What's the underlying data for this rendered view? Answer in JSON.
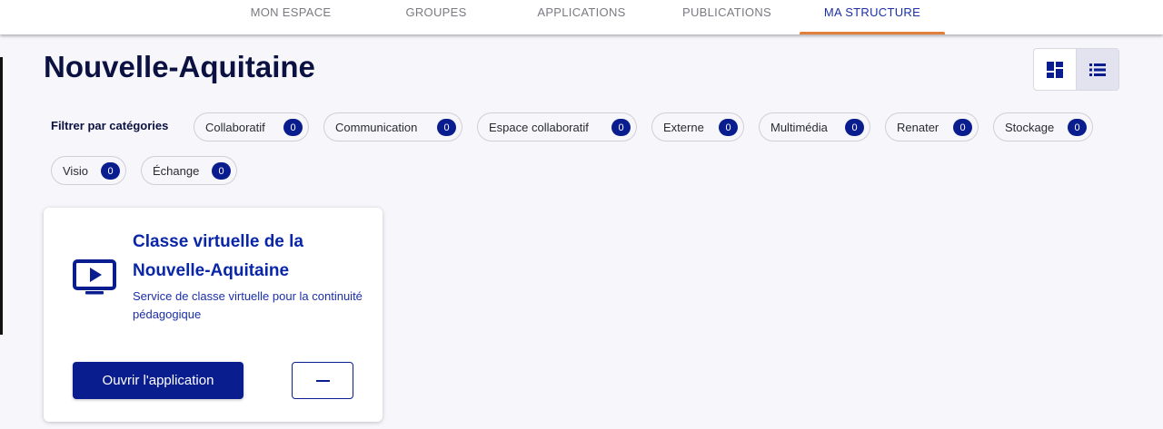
{
  "nav": {
    "tabs": [
      {
        "label": "MON ESPACE"
      },
      {
        "label": "GROUPES"
      },
      {
        "label": "APPLICATIONS"
      },
      {
        "label": "PUBLICATIONS"
      },
      {
        "label": "MA STRUCTURE",
        "active": true
      }
    ]
  },
  "page": {
    "title": "Nouvelle-Aquitaine"
  },
  "view_toggle": {
    "icons": [
      "grid-view-icon",
      "list-view-icon"
    ],
    "active": "list"
  },
  "filters": {
    "label": "Filtrer par catégories",
    "categories": [
      {
        "label": "Collaboratif",
        "count": "0"
      },
      {
        "label": "Communication",
        "count": "0"
      },
      {
        "label": "Espace collaboratif",
        "count": "0"
      },
      {
        "label": "Externe",
        "count": "0"
      },
      {
        "label": "Multimédia",
        "count": "0"
      },
      {
        "label": "Renater",
        "count": "0"
      },
      {
        "label": "Stockage",
        "count": "0"
      },
      {
        "label": "Visio",
        "count": "0"
      },
      {
        "label": "Échange",
        "count": "0"
      }
    ]
  },
  "card": {
    "icon": "video-screen-icon",
    "title": "Classe virtuelle de la Nouvelle-Aquitaine",
    "description": "Service de classe virtuelle pour la continuité pédagogique",
    "open_label": "Ouvrir l'application",
    "remove_icon": "minus-icon"
  },
  "colors": {
    "accent": "#0a1d8f",
    "tab_underline": "#e1803a",
    "title": "#0b1140"
  }
}
